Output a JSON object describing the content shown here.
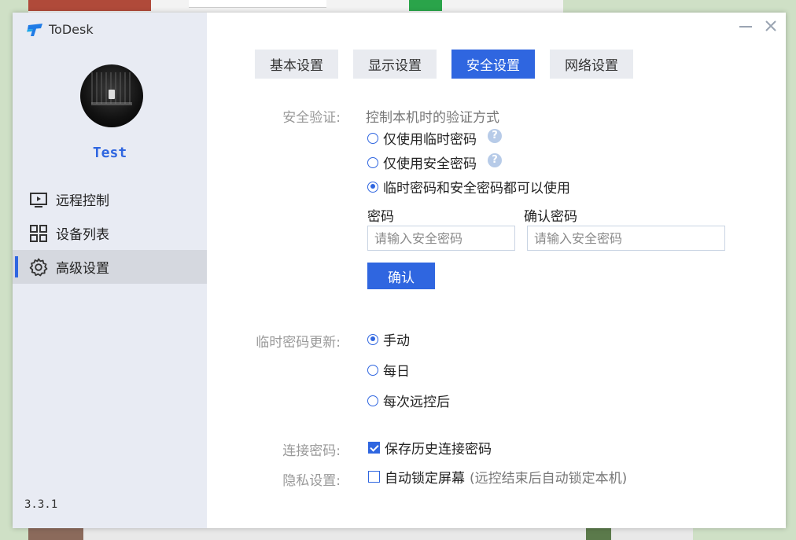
{
  "app": {
    "name": "ToDesk",
    "version": "3.3.1"
  },
  "user": {
    "name": "Test"
  },
  "nav": [
    {
      "label": "远程控制",
      "icon": "remote-control-icon"
    },
    {
      "label": "设备列表",
      "icon": "device-list-icon"
    },
    {
      "label": "高级设置",
      "icon": "gear-icon",
      "active": true
    }
  ],
  "tabs": [
    {
      "label": "基本设置"
    },
    {
      "label": "显示设置"
    },
    {
      "label": "安全设置",
      "active": true
    },
    {
      "label": "网络设置"
    }
  ],
  "security": {
    "label": "安全验证:",
    "description": "控制本机时的验证方式",
    "options": [
      {
        "label": "仅使用临时密码",
        "selected": false,
        "help": "?"
      },
      {
        "label": "仅使用安全密码",
        "selected": false,
        "help": "?"
      },
      {
        "label": "临时密码和安全密码都可以使用",
        "selected": true
      }
    ],
    "password_label": "密码",
    "password_placeholder": "请输入安全密码",
    "confirm_password_label": "确认密码",
    "confirm_password_placeholder": "请输入安全密码",
    "confirm_button": "确认"
  },
  "temp_password_update": {
    "label": "临时密码更新:",
    "options": [
      {
        "label": "手动",
        "selected": true
      },
      {
        "label": "每日",
        "selected": false
      },
      {
        "label": "每次远控后",
        "selected": false
      }
    ]
  },
  "connect_password": {
    "label": "连接密码:",
    "checkbox": "保存历史连接密码",
    "checked": true
  },
  "privacy": {
    "label": "隐私设置:",
    "checkbox": "自动锁定屏幕",
    "note": "(远控结束后自动锁定本机)",
    "checked": false
  },
  "colors": {
    "accent": "#2f66e0",
    "sidebar_bg": "#e8ebf3",
    "tab_bg": "#e9ebf0"
  }
}
